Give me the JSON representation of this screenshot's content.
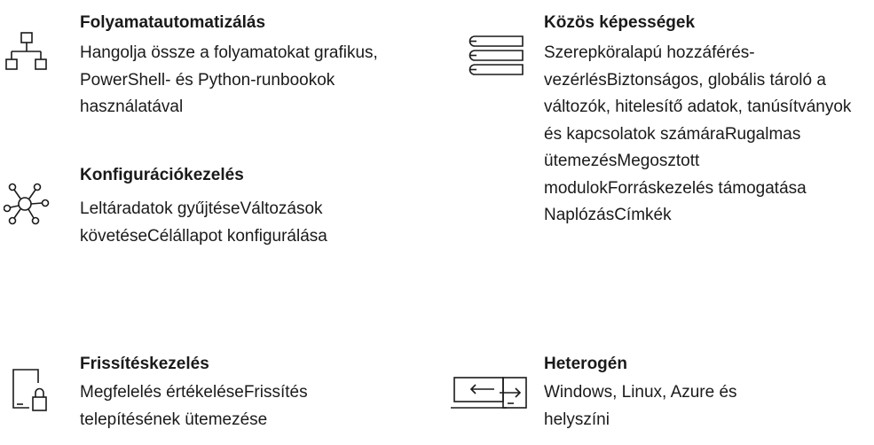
{
  "features": [
    {
      "key": "process-automation",
      "icon": "hierarchy-icon",
      "title": "Folyamatautomatizálás",
      "description": "Hangolja össze a folyamatokat grafikus, PowerShell- és Python-runbookok használatával"
    },
    {
      "key": "configuration-management",
      "icon": "network-hub-icon",
      "title": "Konfigurációkezelés",
      "description": "Leltáradatok gyűjtéseVáltozások követéseCélállapot konfigurálása"
    },
    {
      "key": "update-management",
      "icon": "document-lock-icon",
      "title": "Frissítéskezelés",
      "description": "Megfelelés értékeléseFrissítés telepítésének ütemezése"
    },
    {
      "key": "shared-capabilities",
      "icon": "books-stack-icon",
      "title": "Közös képességek",
      "description": "Szerepköralapú hozzáférés-vezérlésBiztonságos, globális tároló a változók, hitelesítő adatok, tanúsítványok és kapcsolatok számáraRugalmas ütemezésMegosztott modulokForráskezelés támogatása NaplózásCímkék"
    },
    {
      "key": "heterogeneous",
      "icon": "monitor-transfer-icon",
      "title": "Heterogén",
      "description": "Windows, Linux, Azure és helyszíni"
    }
  ]
}
